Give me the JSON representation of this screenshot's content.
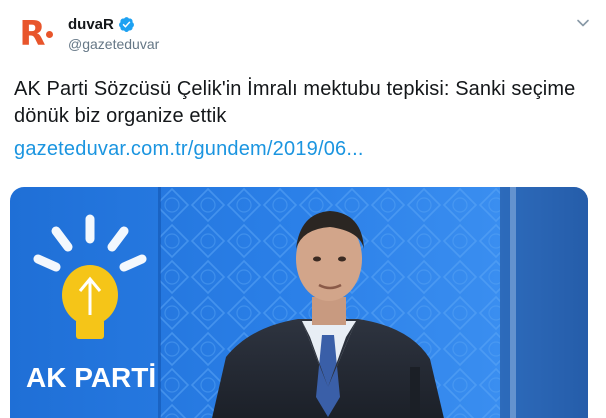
{
  "account": {
    "display_name": "duvaR",
    "handle": "@gazeteduvar",
    "avatar_letter": "R",
    "avatar_icon": "duvar-logo-icon",
    "verified_icon": "verified-badge-icon",
    "accent_color": "#e8552b",
    "verified_color": "#1da1f2"
  },
  "menu_icon": "chevron-down-icon",
  "tweet": {
    "text": "AK Parti Sözcüsü Çelik'in İmralı mektubu tepkisi: Sanki seçime dönük biz organize ettik",
    "link": "gazeteduvar.com.tr/gundem/2019/06...",
    "link_color": "#1b95e0"
  },
  "media": {
    "logo_text": "AK PARTİ"
  }
}
